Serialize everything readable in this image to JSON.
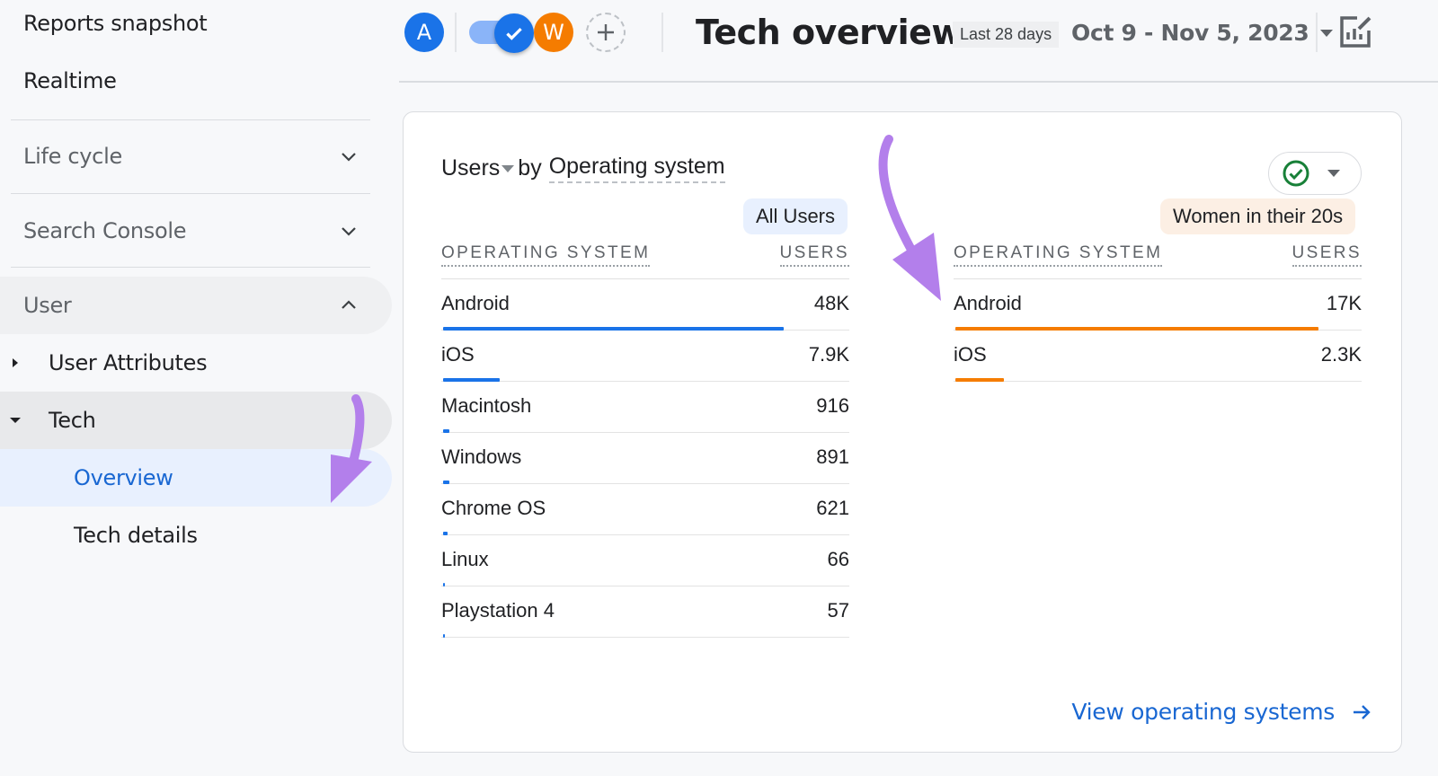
{
  "sidebar": {
    "reports_snapshot": "Reports snapshot",
    "realtime": "Realtime",
    "sections": [
      {
        "label": "Life cycle",
        "expanded": false
      },
      {
        "label": "Search Console",
        "expanded": false
      },
      {
        "label": "User",
        "expanded": true
      }
    ],
    "user_children": [
      {
        "label": "User Attributes",
        "expanded": false
      },
      {
        "label": "Tech",
        "expanded": true
      }
    ],
    "tech_children": [
      {
        "label": "Overview",
        "active": true
      },
      {
        "label": "Tech details",
        "active": false
      }
    ]
  },
  "header": {
    "segments": [
      {
        "initial": "A",
        "color": "#1a73e8"
      },
      {
        "initial": "W",
        "color": "#f57c00"
      }
    ],
    "title": "Tech overview",
    "date_preset": "Last 28 days",
    "date_range": "Oct 9 - Nov 5, 2023"
  },
  "card": {
    "metric": "Users",
    "by": "by",
    "dimension": "Operating system",
    "view_link": "View operating systems",
    "column_os": "OPERATING SYSTEM",
    "column_users": "USERS",
    "left": {
      "segment": "All Users",
      "segment_bg": "#e8f0fe",
      "bar_color": "#1a73e8",
      "rows": [
        {
          "name": "Android",
          "value": "48K",
          "share": 0.835
        },
        {
          "name": "iOS",
          "value": "7.9K",
          "share": 0.138
        },
        {
          "name": "Macintosh",
          "value": "916",
          "share": 0.016
        },
        {
          "name": "Windows",
          "value": "891",
          "share": 0.015
        },
        {
          "name": "Chrome OS",
          "value": "621",
          "share": 0.011
        },
        {
          "name": "Linux",
          "value": "66",
          "share": 0.001
        },
        {
          "name": "Playstation 4",
          "value": "57",
          "share": 0.001
        }
      ]
    },
    "right": {
      "segment": "Women in their 20s",
      "segment_bg": "#fcefe4",
      "bar_color": "#f57c00",
      "rows": [
        {
          "name": "Android",
          "value": "17K",
          "share": 0.89
        },
        {
          "name": "iOS",
          "value": "2.3K",
          "share": 0.118
        }
      ]
    }
  },
  "colors": {
    "accent_blue": "#1967d2",
    "annotation_purple": "#b37feb"
  }
}
